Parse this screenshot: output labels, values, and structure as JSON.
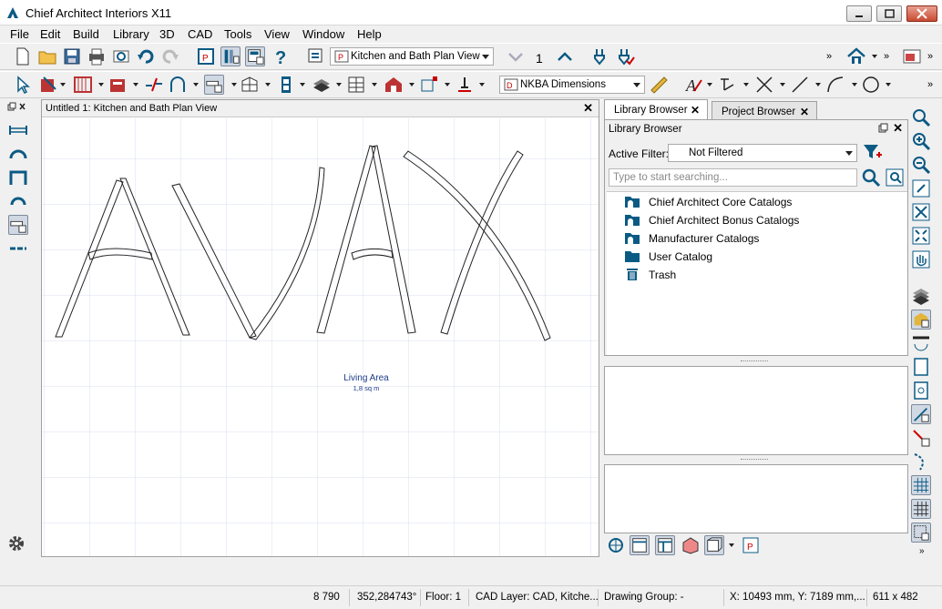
{
  "window": {
    "title": "Chief Architect Interiors X11"
  },
  "menu": [
    "File",
    "Edit",
    "Build",
    "Library",
    "3D",
    "CAD",
    "Tools",
    "View",
    "Window",
    "Help"
  ],
  "toolbar": {
    "view_select": "Kitchen and Bath Plan View",
    "floor_number": "1",
    "dimension_select": "NKBA Dimensions"
  },
  "view": {
    "title": "Untitled 1: Kitchen and Bath Plan View",
    "room_label": "Living Area",
    "room_area": "1,8 sq m"
  },
  "library": {
    "tabs": [
      "Library Browser",
      "Project Browser"
    ],
    "header": "Library Browser",
    "filter_label": "Active Filter:",
    "filter_value": "Not Filtered",
    "search_placeholder": "Type to start searching...",
    "items": [
      {
        "label": "Chief Architect Core Catalogs",
        "icon": "catalog-icon"
      },
      {
        "label": "Chief Architect Bonus Catalogs",
        "icon": "catalog-icon"
      },
      {
        "label": "Manufacturer Catalogs",
        "icon": "catalog-icon"
      },
      {
        "label": "User Catalog",
        "icon": "folder-icon"
      },
      {
        "label": "Trash",
        "icon": "trash-icon"
      }
    ]
  },
  "status": {
    "value1": "8 790",
    "angle": "352,284743°",
    "floor": "Floor: 1",
    "cad_layer": "CAD Layer: CAD, Kitche...",
    "drawing_group": "Drawing Group: -",
    "coords": "X: 10493 mm, Y: 7189 mm,...",
    "size": "611 x 482"
  },
  "colors": {
    "accent": "#0b5a84",
    "grid": "#d9dff0",
    "room_text": "#1a3a8a"
  }
}
